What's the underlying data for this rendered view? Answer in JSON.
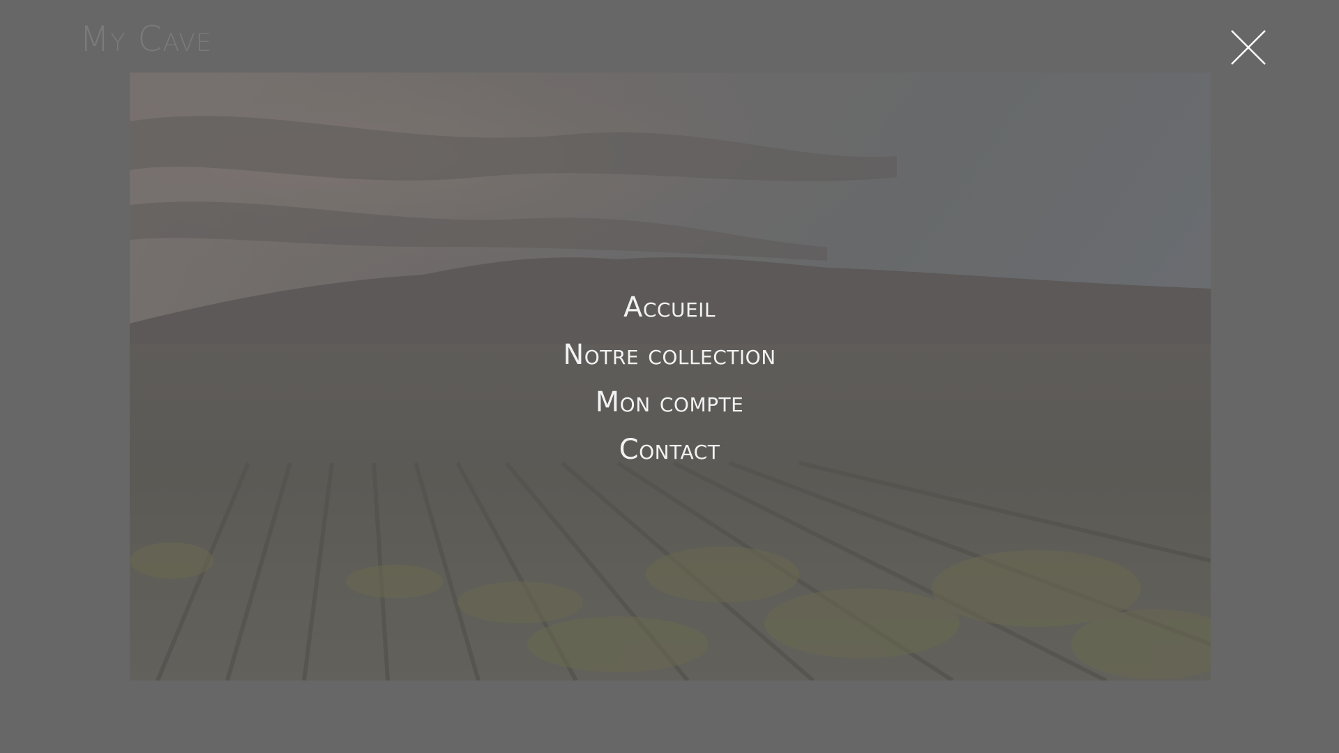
{
  "header": {
    "logo_text": "My Cave",
    "close_icon": "close-icon"
  },
  "hero": {
    "image": "vineyard-landscape-at-dusk",
    "overlay_color": "#676767"
  },
  "nav": {
    "items": [
      {
        "label": "Accueil"
      },
      {
        "label": "Notre collection"
      },
      {
        "label": "Mon compte"
      },
      {
        "label": "Contact"
      }
    ]
  },
  "colors": {
    "overlay": "#676767",
    "menu_text": "#f2f2f2",
    "logo_text": "#7a7a7a"
  }
}
